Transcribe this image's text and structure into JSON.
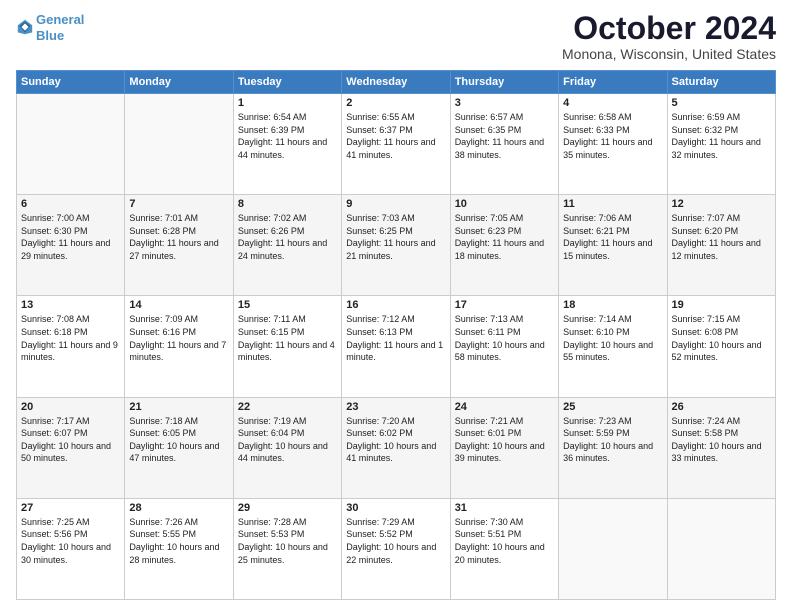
{
  "header": {
    "logo_line1": "General",
    "logo_line2": "Blue",
    "month": "October 2024",
    "location": "Monona, Wisconsin, United States"
  },
  "weekdays": [
    "Sunday",
    "Monday",
    "Tuesday",
    "Wednesday",
    "Thursday",
    "Friday",
    "Saturday"
  ],
  "weeks": [
    [
      {
        "day": "",
        "sunrise": "",
        "sunset": "",
        "daylight": ""
      },
      {
        "day": "",
        "sunrise": "",
        "sunset": "",
        "daylight": ""
      },
      {
        "day": "1",
        "sunrise": "Sunrise: 6:54 AM",
        "sunset": "Sunset: 6:39 PM",
        "daylight": "Daylight: 11 hours and 44 minutes."
      },
      {
        "day": "2",
        "sunrise": "Sunrise: 6:55 AM",
        "sunset": "Sunset: 6:37 PM",
        "daylight": "Daylight: 11 hours and 41 minutes."
      },
      {
        "day": "3",
        "sunrise": "Sunrise: 6:57 AM",
        "sunset": "Sunset: 6:35 PM",
        "daylight": "Daylight: 11 hours and 38 minutes."
      },
      {
        "day": "4",
        "sunrise": "Sunrise: 6:58 AM",
        "sunset": "Sunset: 6:33 PM",
        "daylight": "Daylight: 11 hours and 35 minutes."
      },
      {
        "day": "5",
        "sunrise": "Sunrise: 6:59 AM",
        "sunset": "Sunset: 6:32 PM",
        "daylight": "Daylight: 11 hours and 32 minutes."
      }
    ],
    [
      {
        "day": "6",
        "sunrise": "Sunrise: 7:00 AM",
        "sunset": "Sunset: 6:30 PM",
        "daylight": "Daylight: 11 hours and 29 minutes."
      },
      {
        "day": "7",
        "sunrise": "Sunrise: 7:01 AM",
        "sunset": "Sunset: 6:28 PM",
        "daylight": "Daylight: 11 hours and 27 minutes."
      },
      {
        "day": "8",
        "sunrise": "Sunrise: 7:02 AM",
        "sunset": "Sunset: 6:26 PM",
        "daylight": "Daylight: 11 hours and 24 minutes."
      },
      {
        "day": "9",
        "sunrise": "Sunrise: 7:03 AM",
        "sunset": "Sunset: 6:25 PM",
        "daylight": "Daylight: 11 hours and 21 minutes."
      },
      {
        "day": "10",
        "sunrise": "Sunrise: 7:05 AM",
        "sunset": "Sunset: 6:23 PM",
        "daylight": "Daylight: 11 hours and 18 minutes."
      },
      {
        "day": "11",
        "sunrise": "Sunrise: 7:06 AM",
        "sunset": "Sunset: 6:21 PM",
        "daylight": "Daylight: 11 hours and 15 minutes."
      },
      {
        "day": "12",
        "sunrise": "Sunrise: 7:07 AM",
        "sunset": "Sunset: 6:20 PM",
        "daylight": "Daylight: 11 hours and 12 minutes."
      }
    ],
    [
      {
        "day": "13",
        "sunrise": "Sunrise: 7:08 AM",
        "sunset": "Sunset: 6:18 PM",
        "daylight": "Daylight: 11 hours and 9 minutes."
      },
      {
        "day": "14",
        "sunrise": "Sunrise: 7:09 AM",
        "sunset": "Sunset: 6:16 PM",
        "daylight": "Daylight: 11 hours and 7 minutes."
      },
      {
        "day": "15",
        "sunrise": "Sunrise: 7:11 AM",
        "sunset": "Sunset: 6:15 PM",
        "daylight": "Daylight: 11 hours and 4 minutes."
      },
      {
        "day": "16",
        "sunrise": "Sunrise: 7:12 AM",
        "sunset": "Sunset: 6:13 PM",
        "daylight": "Daylight: 11 hours and 1 minute."
      },
      {
        "day": "17",
        "sunrise": "Sunrise: 7:13 AM",
        "sunset": "Sunset: 6:11 PM",
        "daylight": "Daylight: 10 hours and 58 minutes."
      },
      {
        "day": "18",
        "sunrise": "Sunrise: 7:14 AM",
        "sunset": "Sunset: 6:10 PM",
        "daylight": "Daylight: 10 hours and 55 minutes."
      },
      {
        "day": "19",
        "sunrise": "Sunrise: 7:15 AM",
        "sunset": "Sunset: 6:08 PM",
        "daylight": "Daylight: 10 hours and 52 minutes."
      }
    ],
    [
      {
        "day": "20",
        "sunrise": "Sunrise: 7:17 AM",
        "sunset": "Sunset: 6:07 PM",
        "daylight": "Daylight: 10 hours and 50 minutes."
      },
      {
        "day": "21",
        "sunrise": "Sunrise: 7:18 AM",
        "sunset": "Sunset: 6:05 PM",
        "daylight": "Daylight: 10 hours and 47 minutes."
      },
      {
        "day": "22",
        "sunrise": "Sunrise: 7:19 AM",
        "sunset": "Sunset: 6:04 PM",
        "daylight": "Daylight: 10 hours and 44 minutes."
      },
      {
        "day": "23",
        "sunrise": "Sunrise: 7:20 AM",
        "sunset": "Sunset: 6:02 PM",
        "daylight": "Daylight: 10 hours and 41 minutes."
      },
      {
        "day": "24",
        "sunrise": "Sunrise: 7:21 AM",
        "sunset": "Sunset: 6:01 PM",
        "daylight": "Daylight: 10 hours and 39 minutes."
      },
      {
        "day": "25",
        "sunrise": "Sunrise: 7:23 AM",
        "sunset": "Sunset: 5:59 PM",
        "daylight": "Daylight: 10 hours and 36 minutes."
      },
      {
        "day": "26",
        "sunrise": "Sunrise: 7:24 AM",
        "sunset": "Sunset: 5:58 PM",
        "daylight": "Daylight: 10 hours and 33 minutes."
      }
    ],
    [
      {
        "day": "27",
        "sunrise": "Sunrise: 7:25 AM",
        "sunset": "Sunset: 5:56 PM",
        "daylight": "Daylight: 10 hours and 30 minutes."
      },
      {
        "day": "28",
        "sunrise": "Sunrise: 7:26 AM",
        "sunset": "Sunset: 5:55 PM",
        "daylight": "Daylight: 10 hours and 28 minutes."
      },
      {
        "day": "29",
        "sunrise": "Sunrise: 7:28 AM",
        "sunset": "Sunset: 5:53 PM",
        "daylight": "Daylight: 10 hours and 25 minutes."
      },
      {
        "day": "30",
        "sunrise": "Sunrise: 7:29 AM",
        "sunset": "Sunset: 5:52 PM",
        "daylight": "Daylight: 10 hours and 22 minutes."
      },
      {
        "day": "31",
        "sunrise": "Sunrise: 7:30 AM",
        "sunset": "Sunset: 5:51 PM",
        "daylight": "Daylight: 10 hours and 20 minutes."
      },
      {
        "day": "",
        "sunrise": "",
        "sunset": "",
        "daylight": ""
      },
      {
        "day": "",
        "sunrise": "",
        "sunset": "",
        "daylight": ""
      }
    ]
  ]
}
